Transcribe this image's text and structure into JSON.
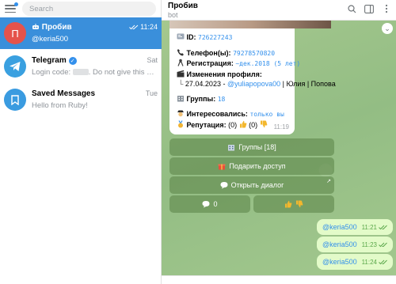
{
  "search": {
    "placeholder": "Search"
  },
  "chats": [
    {
      "avatar_letter": "П",
      "name": "Пробив",
      "time": "11:24",
      "preview": "@keria500",
      "avatar_color": "#e5534b"
    },
    {
      "name": "Telegram",
      "time": "Sat",
      "preview_a": "Login code: ",
      "preview_b": ". Do not give this code",
      "avatar_color": "#3aa0e0"
    },
    {
      "name": "Saved Messages",
      "time": "Tue",
      "preview": "Hello from Ruby!",
      "avatar_color": "#3a9be0"
    }
  ],
  "header": {
    "title": "Пробив",
    "subtitle": "bot"
  },
  "message": {
    "id_label": "ID:",
    "id_value": "726227243",
    "phones_label": "Телефон(ы):",
    "phones_value": "79278570820",
    "reg_label": "Регистрация:",
    "reg_value": "~дек.2018 (5 лет)",
    "profile_label": "Изменения профиля:",
    "profile_date": "27.04.2023 - ",
    "profile_user": "@yuliapopova00",
    "profile_rest": " | Юлия | Попова",
    "groups_label": "Группы:",
    "groups_value": "18",
    "interested_label": "Интересовались:",
    "interested_value": "только вы",
    "rep_label": "Репутация:",
    "rep_value_a": "(0)",
    "rep_value_b": "(0)",
    "time": "11:19"
  },
  "keyboard": {
    "groups": "Группы [18]",
    "gift": "Подарить доступ",
    "open": "Открыть диалог",
    "comments": "0"
  },
  "outgoing": [
    {
      "text": "@keria500",
      "time": "11:21"
    },
    {
      "text": "@keria500",
      "time": "11:23"
    },
    {
      "text": "@keria500",
      "time": "11:24"
    }
  ],
  "colors": {
    "accent": "#3390ec",
    "active_chat": "#3a8fdb",
    "chat_bg": "#9fc48b",
    "out_bubble": "#e3fbc9"
  }
}
